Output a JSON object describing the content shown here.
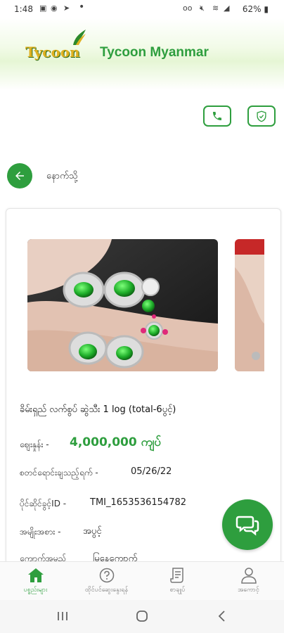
{
  "status_bar": {
    "time": "1:48",
    "battery": "62%"
  },
  "header": {
    "logo_text": "Tycoon",
    "brand_name": "Tycoon Myanmar"
  },
  "back": {
    "label": "နောက်သို့"
  },
  "product": {
    "title": "ခိမ်းရှည် လက်စွပ် ဆွဲသီး 1 log (total-6ပွင့်)",
    "price_label": "ဈေးနှုန်း -",
    "price_value": "4,000,000 ကျပ်",
    "date_label": "စတင်ရောင်းချသည့်ရက် -",
    "date_value": "05/26/22",
    "id_label": "ပိုင်ဆိုင်ခွင့်ID -",
    "id_value": "TMI_1653536154782",
    "type_label": "အမျိုးအစား -",
    "type_value": "အပွင့်",
    "extra_label": "ကျောက်အမည်",
    "extra_value": "မြနေကျောက်"
  },
  "bottom_nav": {
    "items": [
      {
        "label": "ပစ္စည်းများ"
      },
      {
        "label": "ထိုင်ပင်ဆွေးနွေးရန်"
      },
      {
        "label": "စာချုပ်"
      },
      {
        "label": "အကောင့်"
      }
    ]
  },
  "colors": {
    "accent": "#2e9e3e",
    "logo_gold": "#e0b020"
  }
}
